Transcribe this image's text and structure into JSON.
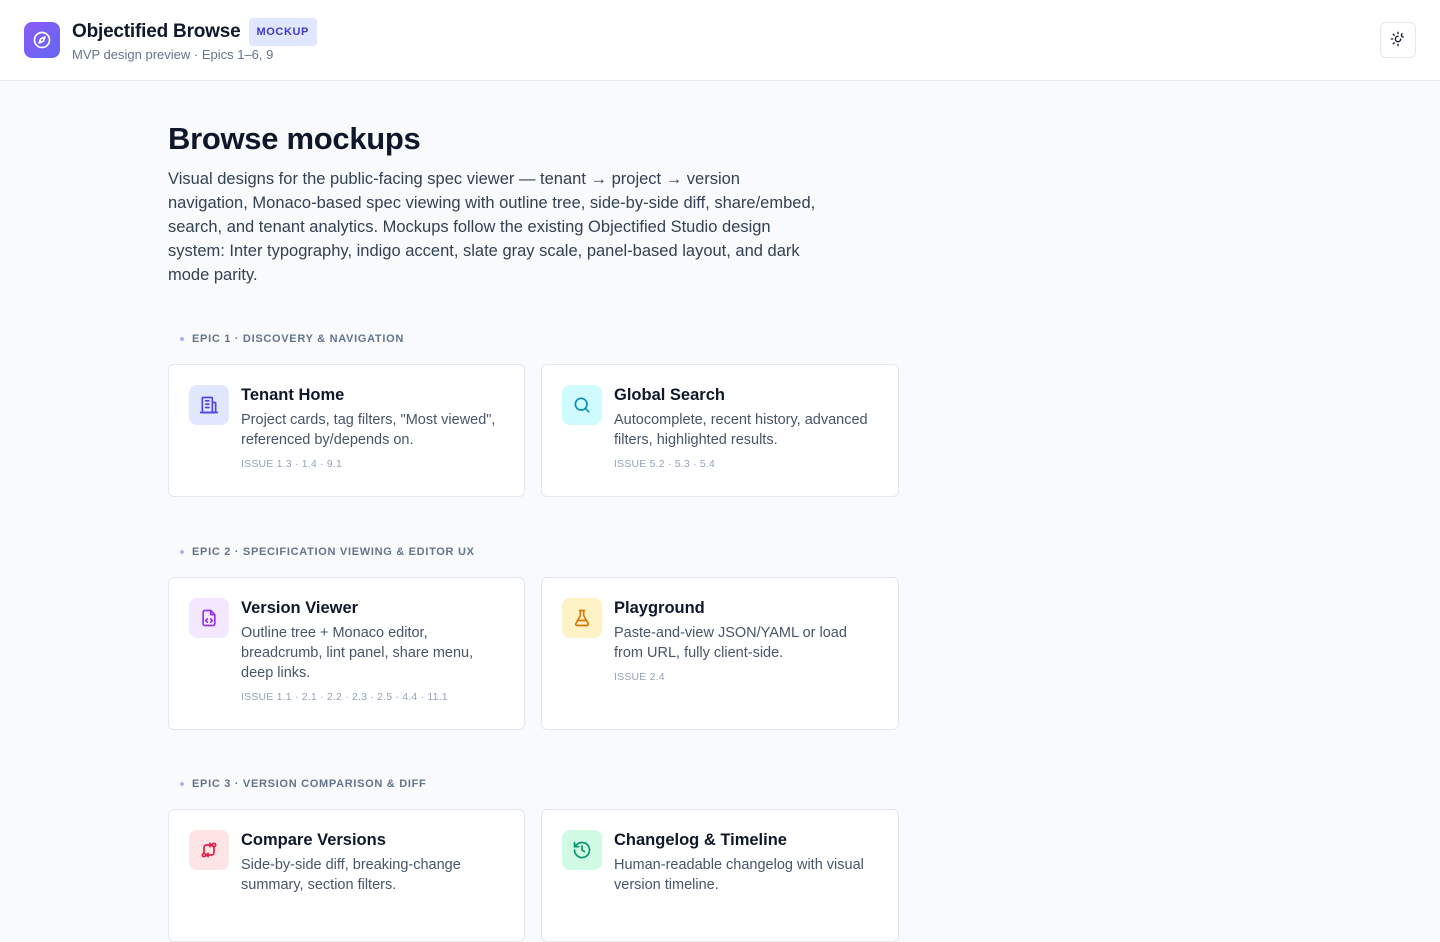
{
  "header": {
    "app_title": "Objectified Browse",
    "badge": "MOCKUP",
    "subtitle": "MVP design preview · Epics 1–6, 9",
    "logo_icon": "compass-icon",
    "theme_icon": "theme-toggle-icon"
  },
  "page": {
    "title": "Browse mockups",
    "intro": "Visual designs for the public-facing spec viewer — tenant → project → version navigation, Monaco-based spec viewing with outline tree, side-by-side diff, share/embed, search, and tenant analytics. Mockups follow the existing Objectified Studio design system: Inter typography, indigo accent, slate gray scale, panel-based layout, and dark mode parity."
  },
  "epics": [
    {
      "label": "EPIC 1 · DISCOVERY & NAVIGATION",
      "cards": [
        {
          "title": "Tenant Home",
          "desc": "Project cards, tag filters, \"Most viewed\", referenced by/depends on.",
          "issue": "ISSUE 1.3 · 1.4 · 9.1",
          "icon": "building-icon",
          "icon_bg": "#e0e7ff",
          "icon_color": "#4f46e5"
        },
        {
          "title": "Global Search",
          "desc": "Autocomplete, recent history, advanced filters, highlighted results.",
          "issue": "ISSUE 5.2 · 5.3 · 5.4",
          "icon": "search-icon",
          "icon_bg": "#cffafe",
          "icon_color": "#0891b2"
        }
      ]
    },
    {
      "label": "EPIC 2 · SPECIFICATION VIEWING & EDITOR UX",
      "cards": [
        {
          "title": "Version Viewer",
          "desc": "Outline tree + Monaco editor, breadcrumb, lint panel, share menu, deep links.",
          "issue": "ISSUE 1.1 · 2.1 · 2.2 · 2.3 · 2.5 · 4.4 · 11.1",
          "icon": "file-code-icon",
          "icon_bg": "#f3e8ff",
          "icon_color": "#9333ea"
        },
        {
          "title": "Playground",
          "desc": "Paste-and-view JSON/YAML or load from URL, fully client-side.",
          "issue": "ISSUE 2.4",
          "icon": "flask-icon",
          "icon_bg": "#fef3c7",
          "icon_color": "#d97706"
        }
      ]
    },
    {
      "label": "EPIC 3 · VERSION COMPARISON & DIFF",
      "cards": [
        {
          "title": "Compare Versions",
          "desc": "Side-by-side diff, breaking-change summary, section filters.",
          "issue": "",
          "icon": "compare-arrows-icon",
          "icon_bg": "#ffe4e6",
          "icon_color": "#e11d48"
        },
        {
          "title": "Changelog & Timeline",
          "desc": "Human-readable changelog with visual version timeline.",
          "issue": "",
          "icon": "history-icon",
          "icon_bg": "#d1fae5",
          "icon_color": "#059669"
        }
      ]
    }
  ]
}
